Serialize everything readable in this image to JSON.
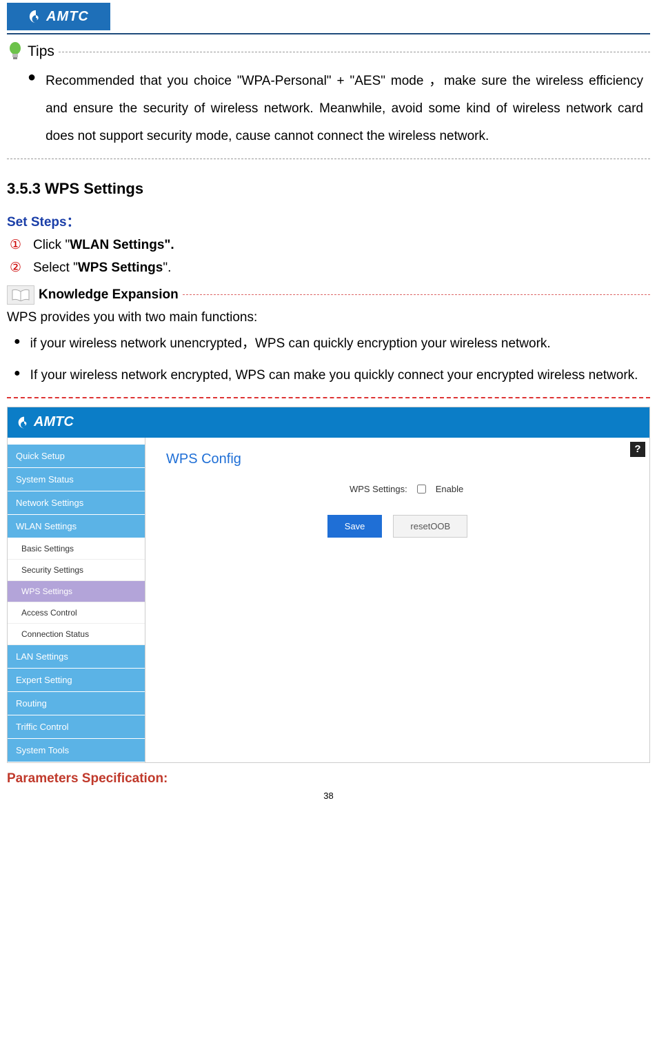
{
  "brand": "AMTC",
  "tips": {
    "label": "Tips",
    "bullet1": "Recommended that you choice \"WPA-Personal\" + \"AES\" mode ，make sure the wireless efficiency and ensure the security of wireless network. Meanwhile, avoid some kind of wireless network card does not support security mode, cause cannot connect the wireless network."
  },
  "section_heading": "3.5.3 WPS Settings",
  "set_steps_label": "Set Steps：",
  "steps": {
    "s1_num": "①",
    "s1_a": "Click \"",
    "s1_b": "WLAN Settings",
    "s1_c": "\".",
    "s2_num": "②",
    "s2_a": "Select \"",
    "s2_b": "WPS Settings",
    "s2_c": "\"."
  },
  "knowledge_label": "Knowledge Expansion",
  "wps_intro": "WPS provides you with two main functions:",
  "wps_items": {
    "i1": "if your wireless network unencrypted，WPS can quickly encryption your wireless network.",
    "i2": "If your wireless network encrypted, WPS can make you quickly connect your encrypted wireless network."
  },
  "app": {
    "brand": "AMTC",
    "sidebar": {
      "quick_setup": "Quick Setup",
      "system_status": "System Status",
      "network_settings": "Network Settings",
      "wlan_settings": "WLAN Settings",
      "basic_settings": "Basic Settings",
      "security_settings": "Security Settings",
      "wps_settings": "WPS Settings",
      "access_control": "Access Control",
      "connection_status": "Connection Status",
      "lan_settings": "LAN Settings",
      "expert_setting": "Expert Setting",
      "routing": "Routing",
      "traffic_control": "Triffic Control",
      "system_tools": "System Tools"
    },
    "panel": {
      "title": "WPS Config",
      "wps_label": "WPS Settings:",
      "enable_label": "Enable",
      "save": "Save",
      "reset": "resetOOB"
    },
    "help": "?"
  },
  "params_spec": "Parameters Specification:",
  "page_number": "38"
}
